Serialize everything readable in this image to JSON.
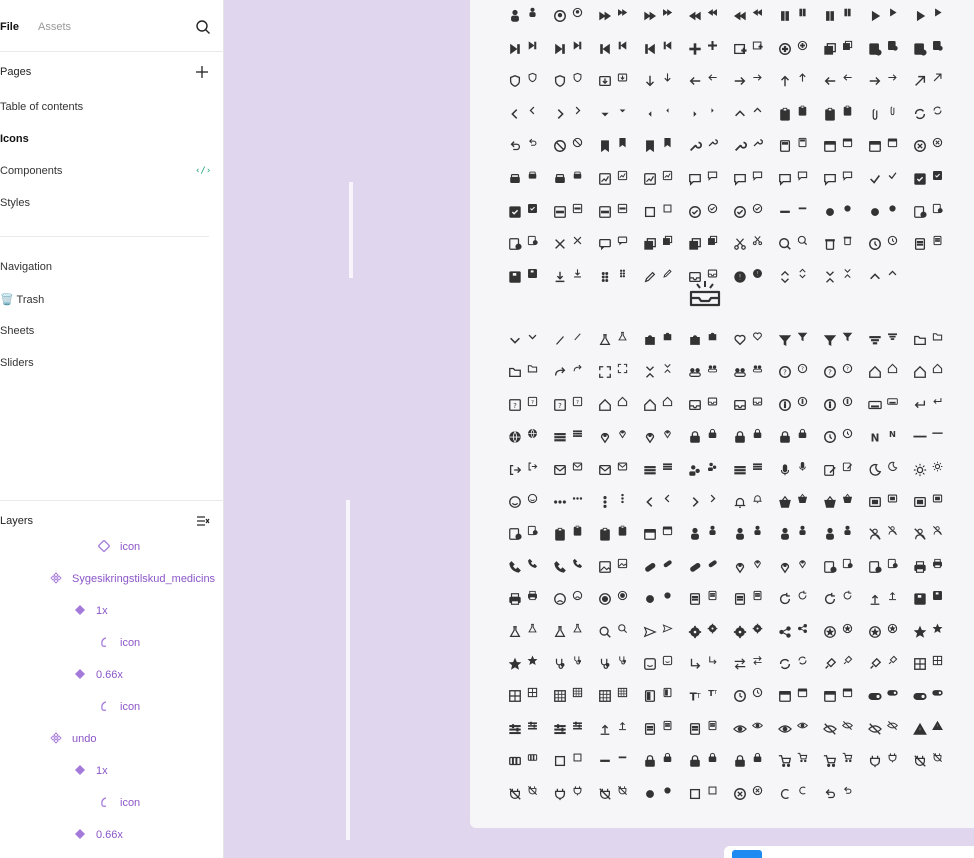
{
  "tabs": {
    "file": "File",
    "assets": "Assets"
  },
  "pages": {
    "title": "Pages",
    "items": [
      {
        "label": "Table of contents",
        "active": false
      },
      {
        "label": "Icons",
        "active": true
      },
      {
        "label": "Components",
        "active": false
      },
      {
        "label": "Styles",
        "active": false
      },
      {
        "label": "Navigation",
        "active": false
      },
      {
        "label": "🗑️ Trash",
        "active": false
      },
      {
        "label": "Sheets",
        "active": false
      },
      {
        "label": "Sliders",
        "active": false
      }
    ]
  },
  "layers": {
    "title": "Layers",
    "items": [
      {
        "label": "icon",
        "icon": "component-instance-icon"
      },
      {
        "label": "Sygesikringstilskud_medicins",
        "icon": "component-set-icon"
      },
      {
        "label": "1x",
        "icon": "component-icon"
      },
      {
        "label": "icon",
        "icon": "vector-icon"
      },
      {
        "label": "0.66x",
        "icon": "component-icon"
      },
      {
        "label": "icon",
        "icon": "vector-icon"
      },
      {
        "label": "undo",
        "icon": "component-set-icon"
      },
      {
        "label": "1x",
        "icon": "component-icon"
      },
      {
        "label": "icon",
        "icon": "vector-icon"
      },
      {
        "label": "0.66x",
        "icon": "component-icon"
      }
    ]
  },
  "colors": {
    "canvas": "#e0d7ee",
    "frame": "#f6f5f8",
    "layer_text": "#8b56c8",
    "code_icon": "#1aa37a",
    "icon_ink": "#333333"
  },
  "grid_icons": [
    "person",
    "person",
    "account-circle",
    "account-circle",
    "fast-forward",
    "fast-forward",
    "fast-forward",
    "fast-forward",
    "rewind",
    "rewind",
    "rewind",
    "rewind",
    "pause",
    "pause",
    "pause",
    "pause",
    "play",
    "play",
    "play",
    "play",
    "skip-next",
    "skip-next",
    "skip-next",
    "skip-next",
    "skip-prev",
    "skip-prev",
    "skip-prev",
    "skip-prev",
    "plus",
    "plus",
    "calendar-add",
    "calendar-add",
    "add-circle",
    "add-circle",
    "copy",
    "copy",
    "receipt-add",
    "receipt-add",
    "receipt-add",
    "receipt-add",
    "shield-check",
    "shield-check",
    "shield-check",
    "shield-check",
    "download-box",
    "download-box",
    "arrow-down",
    "arrow-down",
    "arrow-left",
    "arrow-left",
    "arrow-right",
    "arrow-right",
    "arrow-up",
    "arrow-up",
    "arrow-left",
    "arrow-left",
    "arrow-right",
    "arrow-right",
    "arrow-up-right",
    "arrow-up-right",
    "chevron-left",
    "chevron-left",
    "chevron-right",
    "chevron-right",
    "caret-down",
    "caret-down",
    "dot-left",
    "dot-left",
    "dot-right",
    "dot-right",
    "caret-up",
    "caret-up",
    "clipboard",
    "clipboard",
    "clipboard",
    "clipboard",
    "attachment",
    "attachment",
    "sync",
    "sync",
    "undo",
    "undo",
    "block",
    "block",
    "bookmark",
    "bookmark",
    "bookmark",
    "bookmark",
    "wrench",
    "wrench",
    "wrench",
    "wrench",
    "calculator",
    "calculator",
    "calendar",
    "calendar",
    "calendar",
    "calendar",
    "cancel",
    "cancel",
    "car",
    "car",
    "car",
    "car",
    "chart",
    "chart",
    "chart",
    "chart",
    "chat",
    "chat",
    "chat",
    "chat",
    "chat",
    "chat",
    "chat",
    "chat",
    "check",
    "check",
    "checkbox",
    "checkbox",
    "checkbox",
    "checkbox",
    "minus-box",
    "minus-box",
    "minus-box",
    "minus-box",
    "square",
    "square",
    "check-circle",
    "check-circle",
    "check-circle",
    "check-circle",
    "dash",
    "dash",
    "circle",
    "circle",
    "circle",
    "circle",
    "receipt",
    "receipt",
    "receipt",
    "receipt",
    "close",
    "close",
    "comment",
    "comment",
    "copy",
    "copy",
    "copy",
    "copy",
    "scissors",
    "scissors",
    "zoom",
    "zoom",
    "trash",
    "trash",
    "history",
    "history",
    "document",
    "document",
    "save",
    "save",
    "download",
    "download",
    "drag",
    "drag",
    "pencil",
    "pencil",
    "inbox",
    "inbox",
    "alert",
    "alert",
    "unfold",
    "unfold",
    "collapse",
    "collapse",
    "caret-up",
    "caret-up",
    "",
    ""
  ],
  "grid_icons_lower": [
    "chevron-down",
    "chevron-down",
    "slash",
    "slash",
    "flask",
    "flask",
    "puzzle",
    "puzzle",
    "puzzle",
    "puzzle",
    "heart",
    "heart",
    "filter",
    "filter",
    "filter",
    "filter",
    "sort",
    "sort",
    "folder",
    "folder",
    "folder",
    "folder",
    "redo",
    "redo",
    "expand",
    "expand",
    "collapse",
    "collapse",
    "group",
    "group",
    "group",
    "group",
    "help",
    "help",
    "help",
    "help",
    "home",
    "home",
    "home",
    "home",
    "help-box",
    "help-box",
    "help-box",
    "help-box",
    "home",
    "home",
    "home",
    "home",
    "inbox",
    "inbox",
    "inbox",
    "inbox",
    "info",
    "info",
    "info",
    "info",
    "keyboard",
    "keyboard",
    "return",
    "return",
    "globe",
    "globe",
    "list",
    "list",
    "pin",
    "pin",
    "pin",
    "pin",
    "lock",
    "lock",
    "lock",
    "lock",
    "lock",
    "lock",
    "history",
    "history",
    "n",
    "n",
    "text",
    "text",
    "logout",
    "logout",
    "mail",
    "mail",
    "mail",
    "mail",
    "menu",
    "menu",
    "people",
    "people",
    "menu",
    "menu",
    "mic",
    "mic",
    "edit",
    "edit",
    "moon",
    "moon",
    "sun",
    "sun",
    "smile",
    "smile",
    "more",
    "more",
    "more-vert",
    "more-vert",
    "chevron-left",
    "chevron-left",
    "chevron-right",
    "chevron-right",
    "bell",
    "bell",
    "basket",
    "basket",
    "basket",
    "basket",
    "screen",
    "screen",
    "screen",
    "screen",
    "receipt",
    "receipt",
    "clipboard",
    "clipboard",
    "clipboard",
    "clipboard",
    "calendar",
    "calendar",
    "person",
    "person",
    "person",
    "person",
    "person",
    "person",
    "person",
    "person",
    "user-off",
    "user-off",
    "user-off",
    "user-off",
    "phone",
    "phone",
    "phone",
    "phone",
    "image",
    "image",
    "pill",
    "pill",
    "pill",
    "pill",
    "pin",
    "pin",
    "pin",
    "pin",
    "receipt",
    "receipt",
    "receipt",
    "receipt",
    "print",
    "print",
    "print",
    "print",
    "sad",
    "sad",
    "radio",
    "radio",
    "circle",
    "circle",
    "document",
    "document",
    "document",
    "document",
    "refresh",
    "refresh",
    "refresh",
    "refresh",
    "upload",
    "upload",
    "save",
    "save",
    "flask",
    "flask",
    "flask",
    "flask",
    "search",
    "search",
    "send",
    "send",
    "settings",
    "settings",
    "settings",
    "settings",
    "share",
    "share",
    "star-circle",
    "star-circle",
    "star-circle",
    "star-circle",
    "star",
    "star",
    "star",
    "star",
    "stethoscope",
    "stethoscope",
    "stethoscope",
    "stethoscope",
    "sticker",
    "sticker",
    "subdirectory",
    "subdirectory",
    "swap",
    "swap",
    "sync",
    "sync",
    "syringe",
    "syringe",
    "syringe",
    "syringe",
    "table",
    "table",
    "table",
    "table",
    "grid",
    "grid",
    "grid",
    "grid",
    "tablet",
    "tablet",
    "text-size",
    "text-size",
    "clock",
    "clock",
    "calendar",
    "calendar",
    "calendar",
    "calendar",
    "toggle",
    "toggle",
    "toggle",
    "toggle",
    "tune",
    "tune",
    "tune",
    "tune",
    "upload",
    "upload",
    "document",
    "document",
    "document",
    "document",
    "eye",
    "eye",
    "eye",
    "eye",
    "eye-off",
    "eye-off",
    "eye-off",
    "eye-off",
    "warning",
    "warning",
    "wallet",
    "wallet",
    "square",
    "square",
    "dash",
    "dash",
    "lock",
    "lock",
    "lock",
    "lock",
    "lock",
    "lock",
    "cart",
    "cart",
    "cart",
    "cart",
    "plug",
    "plug",
    "plug-off",
    "plug-off",
    "plug-off",
    "plug-off",
    "plug",
    "plug",
    "plug-off",
    "plug-off",
    "circle",
    "circle",
    "square",
    "square",
    "cancel",
    "cancel",
    "circle-open",
    "circle-open",
    "undo",
    "undo"
  ]
}
